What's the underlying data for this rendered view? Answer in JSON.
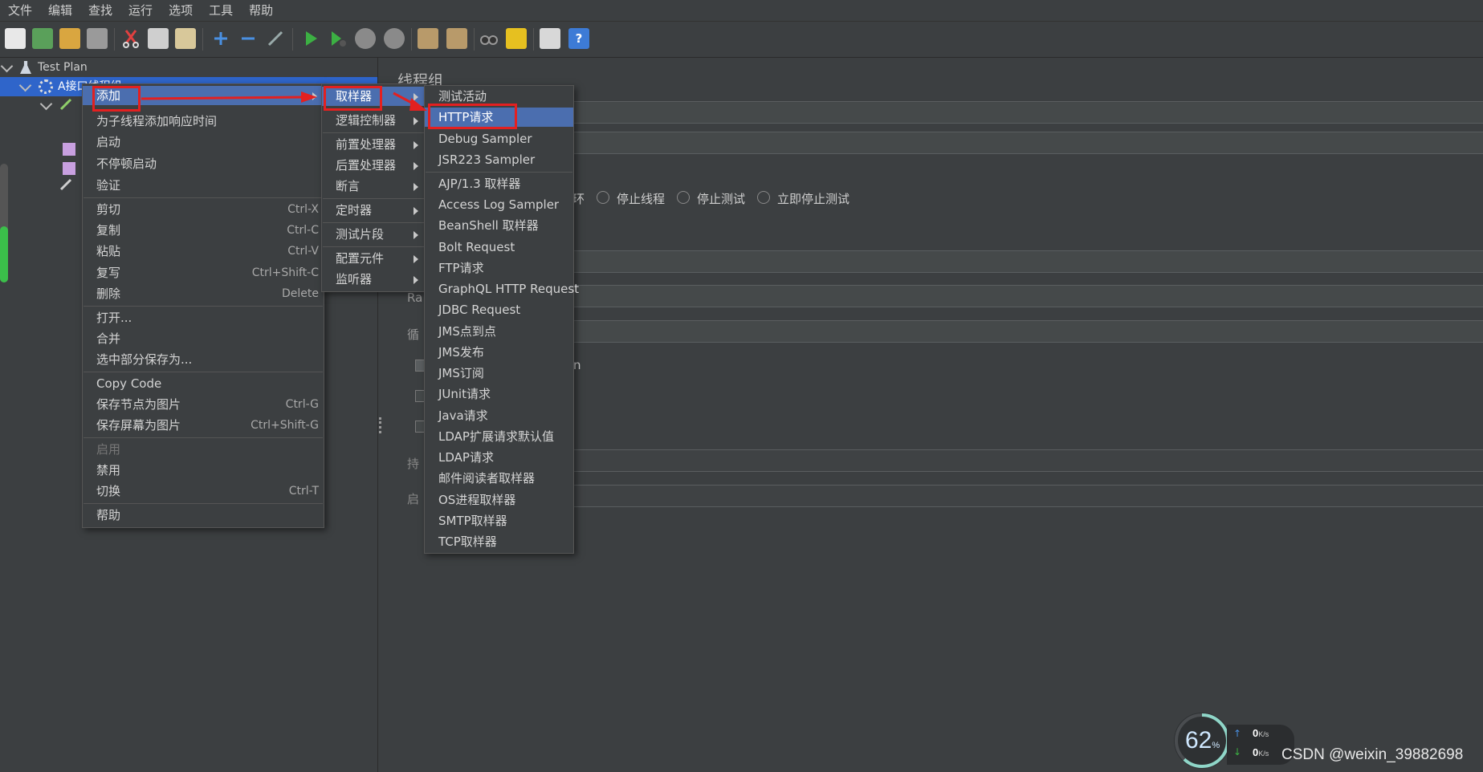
{
  "menubar": [
    "文件",
    "编辑",
    "查找",
    "运行",
    "选项",
    "工具",
    "帮助"
  ],
  "toolbar_icons": [
    "new-icon",
    "templates-icon",
    "open-icon",
    "save-icon",
    "cut-icon",
    "copy-icon",
    "paste-icon",
    "expand-icon",
    "collapse-icon",
    "toggle-icon",
    "start-icon",
    "start-no-pause-icon",
    "stop-icon",
    "shutdown-icon",
    "clear-icon",
    "clear-all-icon",
    "search-icon",
    "reset-search-icon",
    "function-helper-icon",
    "help-icon"
  ],
  "tree": {
    "test_plan": "Test Plan",
    "thread_group": "A接口线程组"
  },
  "right": {
    "title": "线程组",
    "radio_labels": [
      "环",
      "停止线程",
      "停止测试",
      "立即停止测试"
    ],
    "label_ramp": "Ra",
    "label_loop": "循",
    "label_n": "n",
    "label_duration": "持",
    "label_startup": "启"
  },
  "context_menu": {
    "items": [
      {
        "label": "添加",
        "shortcut": "",
        "submenu": true,
        "highlight": true
      },
      {
        "label": "为子线程添加响应时间",
        "shortcut": ""
      },
      {
        "label": "启动",
        "shortcut": ""
      },
      {
        "label": "不停顿启动",
        "shortcut": ""
      },
      {
        "label": "验证",
        "shortcut": ""
      },
      {
        "label": "剪切",
        "shortcut": "Ctrl-X"
      },
      {
        "label": "复制",
        "shortcut": "Ctrl-C"
      },
      {
        "label": "粘贴",
        "shortcut": "Ctrl-V"
      },
      {
        "label": "复写",
        "shortcut": "Ctrl+Shift-C"
      },
      {
        "label": "删除",
        "shortcut": "Delete"
      },
      {
        "label": "打开...",
        "shortcut": ""
      },
      {
        "label": "合并",
        "shortcut": ""
      },
      {
        "label": "选中部分保存为...",
        "shortcut": ""
      },
      {
        "label": "Copy Code",
        "shortcut": ""
      },
      {
        "label": "保存节点为图片",
        "shortcut": "Ctrl-G"
      },
      {
        "label": "保存屏幕为图片",
        "shortcut": "Ctrl+Shift-G"
      },
      {
        "label": "启用",
        "shortcut": "",
        "disabled": true
      },
      {
        "label": "禁用",
        "shortcut": ""
      },
      {
        "label": "切换",
        "shortcut": "Ctrl-T"
      },
      {
        "label": "帮助",
        "shortcut": ""
      }
    ]
  },
  "add_submenu": {
    "items": [
      "取样器",
      "逻辑控制器",
      "前置处理器",
      "后置处理器",
      "断言",
      "定时器",
      "测试片段",
      "配置元件",
      "监听器"
    ]
  },
  "sampler_submenu": {
    "items": [
      "测试活动",
      "HTTP请求",
      "Debug Sampler",
      "JSR223 Sampler",
      "AJP/1.3 取样器",
      "Access Log Sampler",
      "BeanShell 取样器",
      "Bolt Request",
      "FTP请求",
      "GraphQL HTTP Request",
      "JDBC Request",
      "JMS点到点",
      "JMS发布",
      "JMS订阅",
      "JUnit请求",
      "Java请求",
      "LDAP扩展请求默认值",
      "LDAP请求",
      "邮件阅读者取样器",
      "OS进程取样器",
      "SMTP取样器",
      "TCP取样器"
    ]
  },
  "net_widget": {
    "percent": "62",
    "percent_unit": "%",
    "up_value": "0",
    "down_value": "0",
    "unit": "K/s",
    "usage_fraction": 0.62
  },
  "watermark": "CSDN @weixin_39882698",
  "colors": {
    "background": "#3c3f41",
    "highlight": "#4b6eaf",
    "annotation_red": "#e32020"
  }
}
